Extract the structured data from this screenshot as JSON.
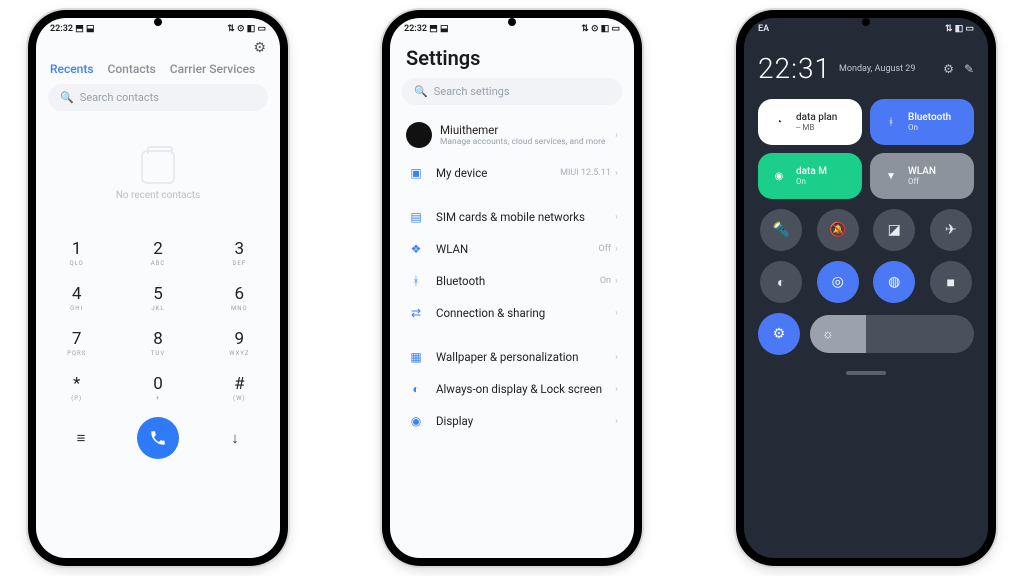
{
  "status": {
    "time": "22:32",
    "indicators": "⬒ ⬓",
    "right": "⇅ ⊙ ◧ ▭"
  },
  "phone1": {
    "tabs": [
      "Recents",
      "Contacts",
      "Carrier Services"
    ],
    "active_tab": 0,
    "search_placeholder": "Search contacts",
    "empty_text": "No recent contacts",
    "keys": [
      {
        "n": "1",
        "l": "QLO"
      },
      {
        "n": "2",
        "l": "ABC"
      },
      {
        "n": "3",
        "l": "DEF"
      },
      {
        "n": "4",
        "l": "GHI"
      },
      {
        "n": "5",
        "l": "JKL"
      },
      {
        "n": "6",
        "l": "MNO"
      },
      {
        "n": "7",
        "l": "PQRS"
      },
      {
        "n": "8",
        "l": "TUV"
      },
      {
        "n": "9",
        "l": "WXYZ"
      },
      {
        "n": "*",
        "l": "(P)"
      },
      {
        "n": "0",
        "l": "+"
      },
      {
        "n": "#",
        "l": "(W)"
      }
    ]
  },
  "phone2": {
    "title": "Settings",
    "search_placeholder": "Search settings",
    "account": {
      "name": "Miuithemer",
      "sub": "Manage accounts, cloud services, and more"
    },
    "items": [
      {
        "icon": "▣",
        "label": "My device",
        "trail": "MIUI 12.5.11"
      },
      {
        "gap": true
      },
      {
        "icon": "▤",
        "label": "SIM cards & mobile networks",
        "trail": ""
      },
      {
        "icon": "❖",
        "label": "WLAN",
        "trail": "Off"
      },
      {
        "icon": "ᚼ",
        "label": "Bluetooth",
        "trail": "On"
      },
      {
        "icon": "⇄",
        "label": "Connection & sharing",
        "trail": ""
      },
      {
        "gap": true
      },
      {
        "icon": "▦",
        "label": "Wallpaper & personalization",
        "trail": ""
      },
      {
        "icon": "◐",
        "label": "Always-on display & Lock screen",
        "trail": ""
      },
      {
        "icon": "◉",
        "label": "Display",
        "trail": ""
      }
    ]
  },
  "phone3": {
    "status_left": "EA",
    "status_right": "⇅ ◧ ▭",
    "time": "22:31",
    "date": "Monday, August 29",
    "tiles": [
      {
        "style": "white",
        "icon": "◔",
        "label": "data plan",
        "sub": "-- MB"
      },
      {
        "style": "blue",
        "icon": "ᚼ",
        "label": "Bluetooth",
        "sub": "On"
      },
      {
        "style": "green",
        "icon": "◉",
        "label": "data   M",
        "sub": "On"
      },
      {
        "style": "grey",
        "icon": "▼",
        "label": "WLAN",
        "sub": "Off"
      }
    ],
    "ring1": [
      {
        "on": false,
        "icon": "🔦"
      },
      {
        "on": false,
        "icon": "🔕"
      },
      {
        "on": false,
        "icon": "◪"
      },
      {
        "on": false,
        "icon": "✈"
      }
    ],
    "ring2": [
      {
        "on": false,
        "icon": "◐"
      },
      {
        "on": true,
        "icon": "◎"
      },
      {
        "on": true,
        "icon": "◍"
      },
      {
        "on": false,
        "icon": "■"
      }
    ],
    "bottom_btn": "⚙"
  }
}
